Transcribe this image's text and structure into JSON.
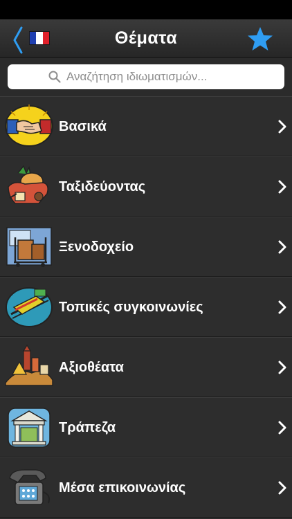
{
  "navbar": {
    "title": "Θέματα",
    "flag_colors": [
      "#1f3fb0",
      "#ffffff",
      "#e0202a"
    ],
    "accent": "#2f9df2"
  },
  "search": {
    "placeholder": "Αναζήτηση ιδιωματισμών..."
  },
  "topics": [
    {
      "label": "Βασικά",
      "icon": "handshake-icon"
    },
    {
      "label": "Ταξιδεύοντας",
      "icon": "travel-basket-icon"
    },
    {
      "label": "Ξενοδοχείο",
      "icon": "hotel-luggage-cart-icon"
    },
    {
      "label": "Τοπικές συγκοινωνίες",
      "icon": "train-icon"
    },
    {
      "label": "Αξιοθέατα",
      "icon": "landmarks-icon"
    },
    {
      "label": "Τράπεζα",
      "icon": "bank-icon"
    },
    {
      "label": "Μέσα επικοινωνίας",
      "icon": "telephone-icon"
    }
  ]
}
